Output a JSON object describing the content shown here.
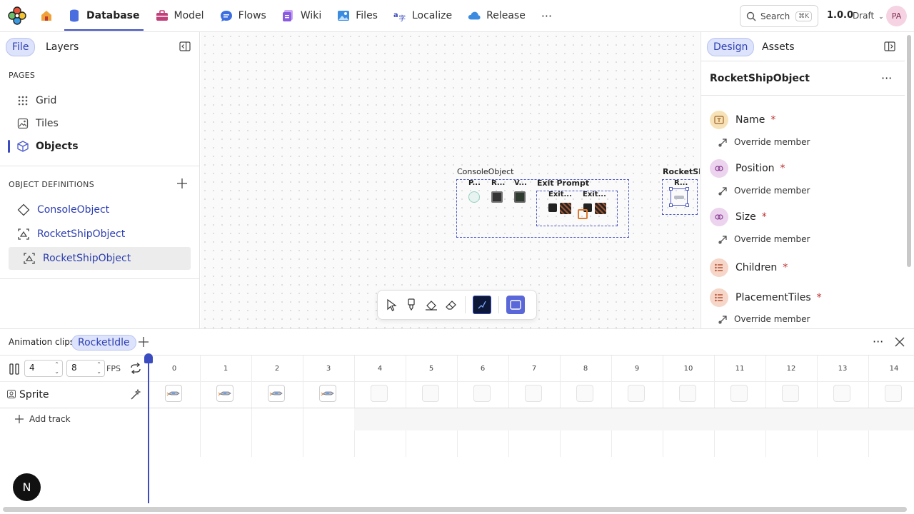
{
  "nav": {
    "items": [
      {
        "label": "Database",
        "icon": "database-icon",
        "color": "#4a6ee0"
      },
      {
        "label": "Model",
        "icon": "toolbox-icon",
        "color": "#c2407a"
      },
      {
        "label": "Flows",
        "icon": "chat-icon",
        "color": "#3d6fe0"
      },
      {
        "label": "Wiki",
        "icon": "layers-icon",
        "color": "#8a5be0"
      },
      {
        "label": "Files",
        "icon": "image-icon",
        "color": "#3b8be0"
      },
      {
        "label": "Localize",
        "icon": "translate-icon",
        "color": "#3b4cc0"
      },
      {
        "label": "Release",
        "icon": "cloud-icon",
        "color": "#3b8be0"
      }
    ],
    "more": "···",
    "search": "Search",
    "shortcut": "⌘K",
    "version": "1.0.0",
    "status": "Draft",
    "avatar": "PA"
  },
  "left": {
    "tab_file": "File",
    "tab_layers": "Layers",
    "pages_title": "PAGES",
    "pages": [
      {
        "label": "Grid",
        "icon": "grid-dots-icon"
      },
      {
        "label": "Tiles",
        "icon": "image-frame-icon"
      },
      {
        "label": "Objects",
        "icon": "cube-icon"
      }
    ],
    "defs_title": "OBJECT DEFINITIONS",
    "defs": [
      {
        "label": "ConsoleObject",
        "icon": "diamond-icon"
      },
      {
        "label": "RocketShipObject",
        "icon": "object-frame-icon"
      },
      {
        "label": "RocketShipObject",
        "icon": "object-frame-icon"
      }
    ]
  },
  "canvas": {
    "console_label": "ConsoleObject",
    "col_p": "P...",
    "col_r": "R...",
    "col_v": "V...",
    "exit_prompt": "Exit Prompt",
    "exit_a": "Exit...",
    "exit_b": "Exit...",
    "rocket_label": "RocketShi",
    "rocket_sub": "R..."
  },
  "right": {
    "tab_design": "Design",
    "tab_assets": "Assets",
    "object_name": "RocketShipObject",
    "more": "···",
    "override": "Override member",
    "required": "*",
    "props": [
      {
        "label": "Name",
        "icon": "text-field-icon",
        "color": "#f7e2b8"
      },
      {
        "label": "Position",
        "icon": "link-icon",
        "color": "#ecd3ee"
      },
      {
        "label": "Size",
        "icon": "link-icon",
        "color": "#ecd3ee"
      },
      {
        "label": "Children",
        "icon": "list-icon",
        "color": "#f6d6c8"
      },
      {
        "label": "PlacementTiles",
        "icon": "list-icon",
        "color": "#f6d6c8"
      }
    ]
  },
  "bottom": {
    "title": "Animation clips",
    "clip": "RocketIdle",
    "frames_value": "4",
    "fps_value": "8",
    "fps_label": "FPS",
    "track": "Sprite",
    "add_track": "Add track",
    "frame_numbers": [
      "0",
      "1",
      "2",
      "3",
      "4",
      "5",
      "6",
      "7",
      "8",
      "9",
      "10",
      "11",
      "12",
      "13",
      "14"
    ],
    "filled_frames": 4,
    "badge": "N",
    "more": "···"
  },
  "colors": {
    "accent": "#3b4cc0",
    "accent_soft": "#dde3fb"
  }
}
